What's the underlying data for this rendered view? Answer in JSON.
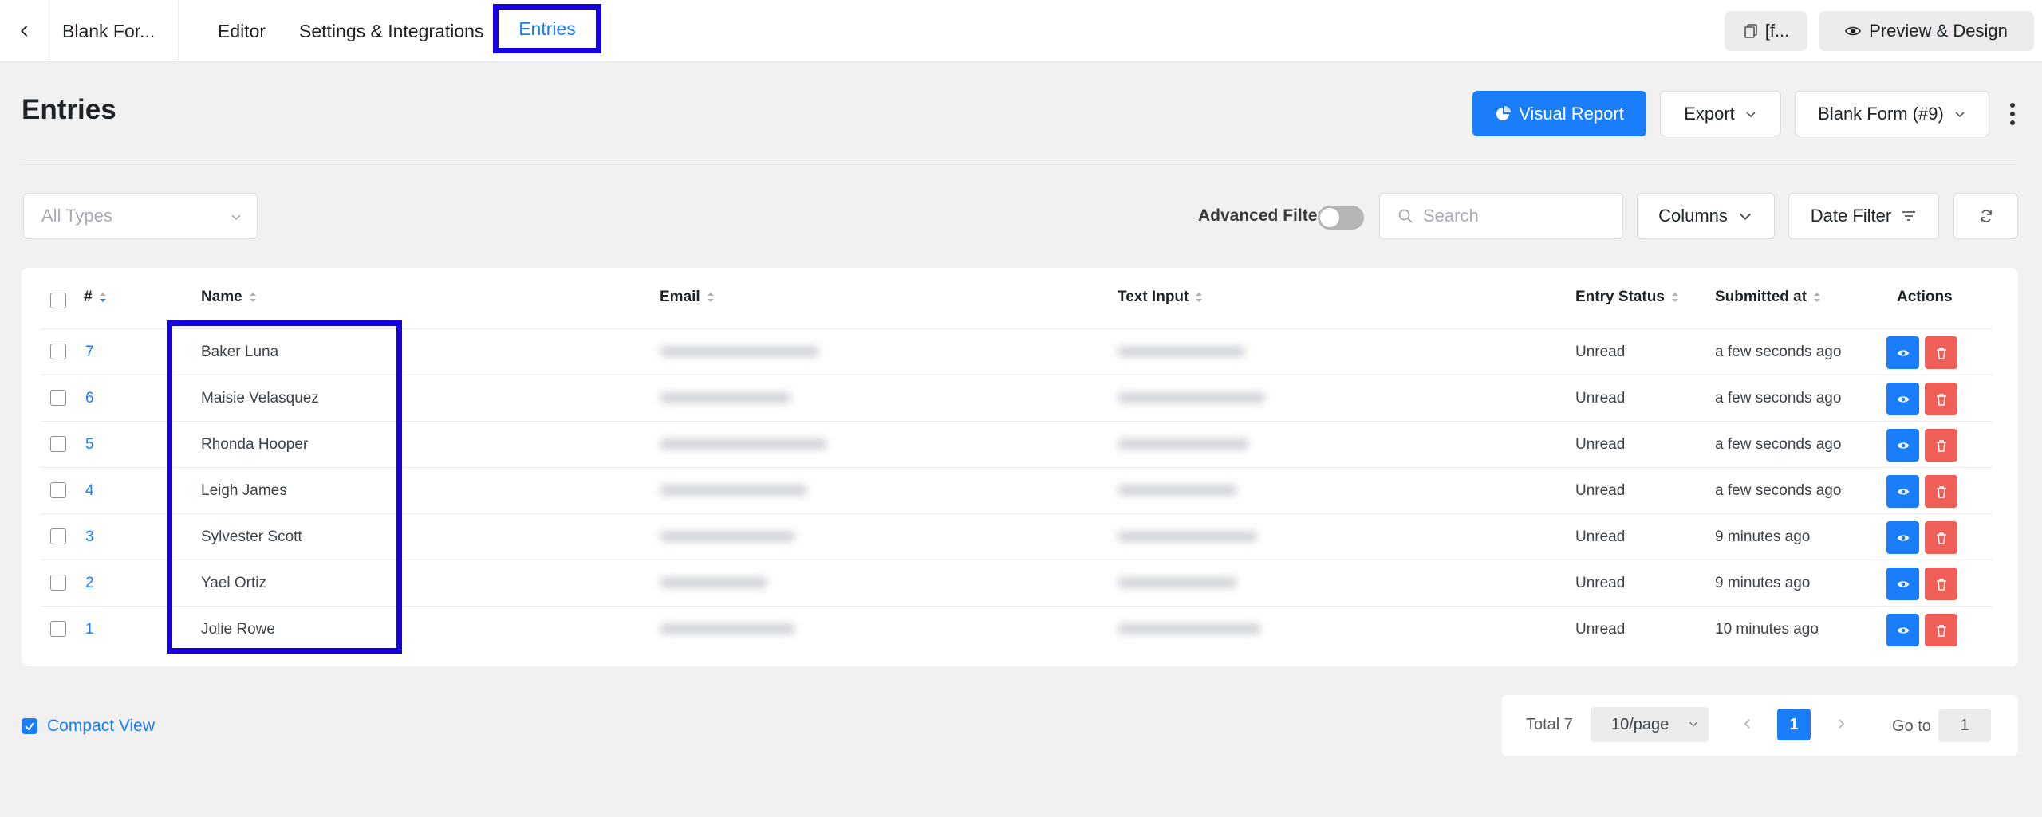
{
  "topbar": {
    "form_title": "Blank For...",
    "tabs": [
      "Editor",
      "Settings & Integrations",
      "Entries"
    ],
    "active_tab": "Entries",
    "shortcode_label": "[f...",
    "preview_label": "Preview & Design"
  },
  "header": {
    "title": "Entries",
    "visual_report": "Visual Report",
    "export": "Export",
    "form_select": "Blank Form (#9)"
  },
  "filters": {
    "type_placeholder": "All Types",
    "advanced_filter": "Advanced Filter",
    "advanced_enabled": false,
    "search_placeholder": "Search",
    "columns": "Columns",
    "date_filter": "Date Filter"
  },
  "table": {
    "columns": [
      "#",
      "Name",
      "Email",
      "Text Input",
      "Entry Status",
      "Submitted at",
      "Actions"
    ],
    "rows": [
      {
        "id": "7",
        "name": "Baker Luna",
        "status": "Unread",
        "submitted": "a few seconds ago"
      },
      {
        "id": "6",
        "name": "Maisie Velasquez",
        "status": "Unread",
        "submitted": "a few seconds ago"
      },
      {
        "id": "5",
        "name": "Rhonda Hooper",
        "status": "Unread",
        "submitted": "a few seconds ago"
      },
      {
        "id": "4",
        "name": "Leigh James",
        "status": "Unread",
        "submitted": "a few seconds ago"
      },
      {
        "id": "3",
        "name": "Sylvester Scott",
        "status": "Unread",
        "submitted": "9 minutes ago"
      },
      {
        "id": "2",
        "name": "Yael Ortiz",
        "status": "Unread",
        "submitted": "9 minutes ago"
      },
      {
        "id": "1",
        "name": "Jolie Rowe",
        "status": "Unread",
        "submitted": "10 minutes ago"
      }
    ]
  },
  "footer": {
    "compact_view": "Compact View",
    "compact_checked": true,
    "total": "Total 7",
    "page_size": "10/page",
    "current_page": "1",
    "goto_label": "Go to",
    "goto_value": "1"
  },
  "colors": {
    "accent": "#1a7efb",
    "danger": "#ef5f58",
    "annotation": "#1500e0"
  }
}
